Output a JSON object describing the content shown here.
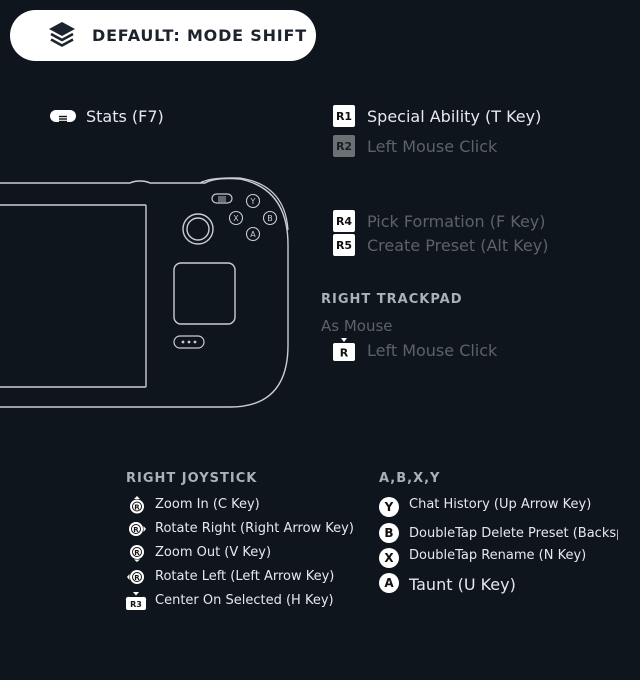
{
  "mode": {
    "label": "DEFAULT: MODE SHIFT",
    "icon": "layers-icon"
  },
  "left_bindings": {
    "stats": {
      "label": "Stats (F7)",
      "icon": "menu-button-icon"
    }
  },
  "right_bumpers": [
    {
      "button": "R1",
      "label": "Special Ability (T Key)",
      "dimmed": false
    },
    {
      "button": "R2",
      "label": "Left Mouse Click",
      "dimmed": true
    }
  ],
  "back_buttons": [
    {
      "button": "R4",
      "label": "Pick Formation (F Key)",
      "dimmed": true
    },
    {
      "button": "R5",
      "label": "Create Preset (Alt Key)",
      "dimmed": true
    }
  ],
  "right_trackpad": {
    "heading": "RIGHT TRACKPAD",
    "mode": "As Mouse",
    "click": {
      "button": "R",
      "label": "Left Mouse Click"
    }
  },
  "right_joystick": {
    "heading": "RIGHT JOYSTICK",
    "items": [
      {
        "direction": "up",
        "label": "Zoom In (C Key)"
      },
      {
        "direction": "right",
        "label": "Rotate Right (Right Arrow Key)"
      },
      {
        "direction": "down",
        "label": "Zoom Out (V Key)"
      },
      {
        "direction": "left",
        "label": "Rotate Left (Left Arrow Key)"
      },
      {
        "direction": "click",
        "button": "R3",
        "label": "Center On Selected (H Key)"
      }
    ]
  },
  "face_buttons": {
    "heading": "A,B,X,Y",
    "items": [
      {
        "button": "Y",
        "label": "Chat History (Up Arrow Key)"
      },
      {
        "button": "B",
        "label": "DoubleTap Delete Preset (Backspa"
      },
      {
        "button": "X",
        "label": "DoubleTap Rename (N Key)"
      },
      {
        "button": "A",
        "label": "Taunt (U Key)"
      }
    ]
  },
  "device_labels": {
    "stick_letter": "R",
    "y": "Y",
    "x": "X",
    "b": "B",
    "a": "A"
  },
  "colors": {
    "background": "#0f151d",
    "pill": "#ffffff",
    "text": "#e6e9ec",
    "dim_text": "#5c6268",
    "heading": "#aab1b8",
    "outline": "#c9ced3"
  }
}
